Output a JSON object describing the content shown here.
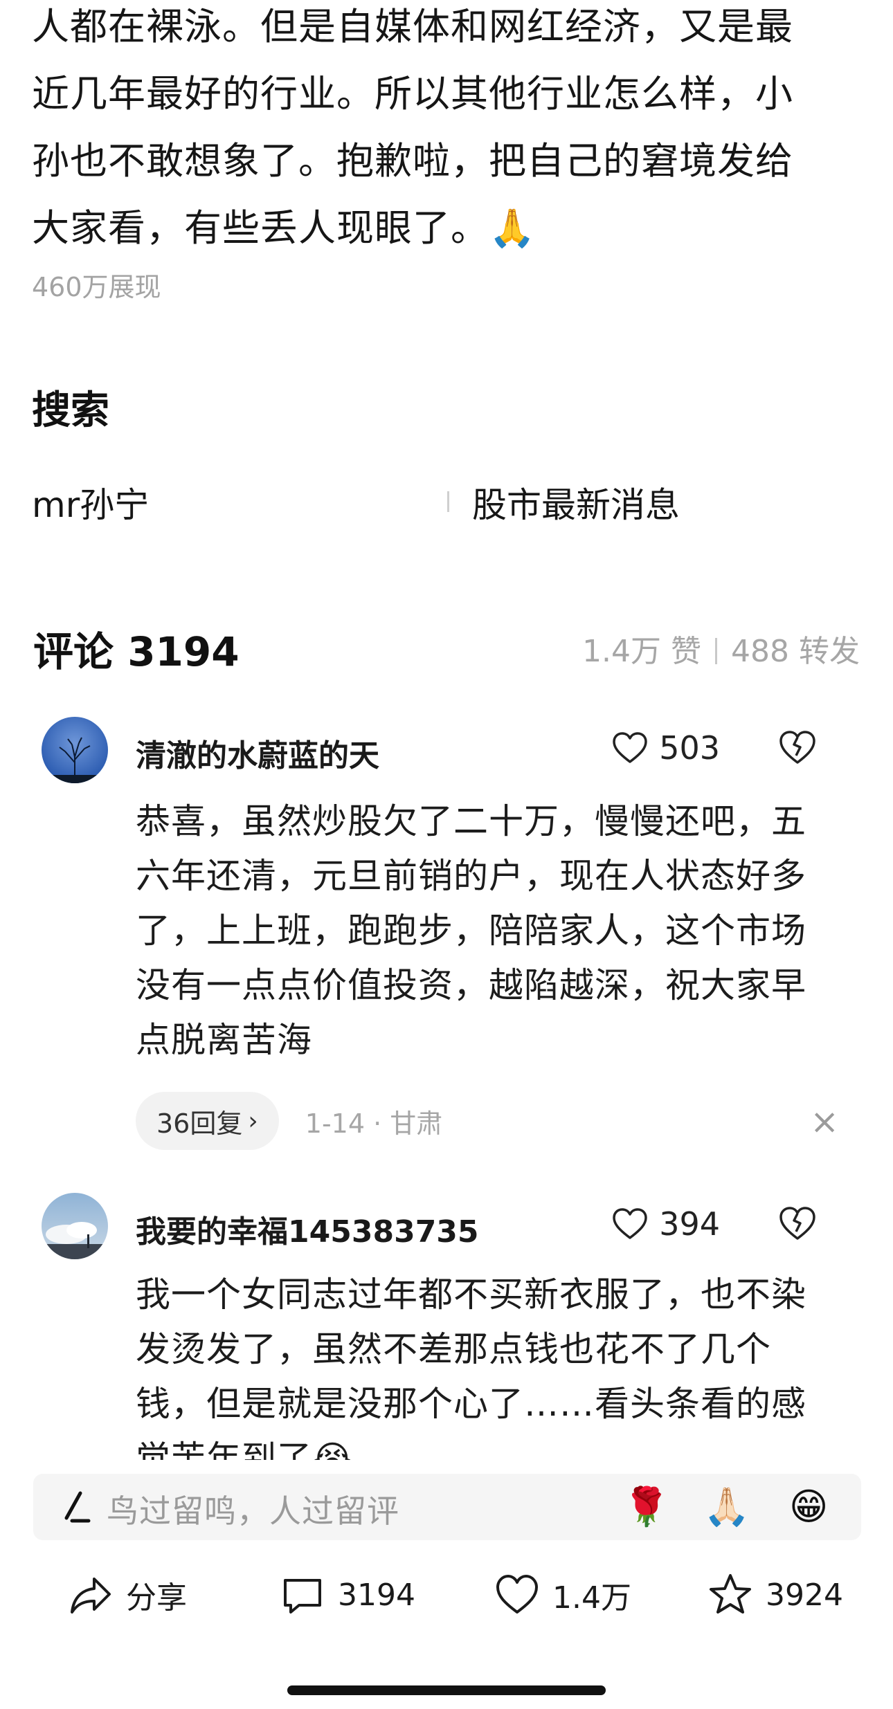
{
  "article": {
    "lines": [
      "人都在裸泳。但是自媒体和网红经济，又是最",
      "近几年最好的行业。所以其他行业怎么样，小",
      "孙也不敢想象了。抱歉啦，把自己的窘境发给",
      "大家看，有些丢人现眼了。🙏"
    ],
    "impressions": "460万展现"
  },
  "search": {
    "title": "搜索",
    "items": [
      "mr孙宁",
      "股市最新消息"
    ]
  },
  "comments": {
    "title": "评论 3194",
    "likes_label": "1.4万 赞",
    "shares_label": "488 转发",
    "list": [
      {
        "user": "清澈的水蔚蓝的天",
        "likes": "503",
        "lines": [
          "恭喜，虽然炒股欠了二十万，慢慢还吧，五",
          "六年还清，元旦前销的户，现在人状态好多",
          "了，上上班，跑跑步，陪陪家人，这个市场",
          "没有一点点价值投资，越陷越深，祝大家早",
          "点脱离苦海"
        ],
        "replies": "36回复",
        "meta": "1-14 · 甘肃"
      },
      {
        "user": "我要的幸福145383735",
        "likes": "394",
        "lines": [
          "我一个女同志过年都不买新衣服了，也不染",
          "发烫发了，虽然不差那点钱也花不了几个",
          "钱，但是就是没那个心了……看头条看的感",
          "觉苦年到了😭"
        ]
      }
    ]
  },
  "input": {
    "placeholder": "鸟过留鸣，人过留评",
    "emojis": [
      "🌹",
      "🙏🏻",
      "😁"
    ]
  },
  "bottom_nav": {
    "share": "分享",
    "comments": "3194",
    "likes": "1.4万",
    "favorites": "3924"
  }
}
